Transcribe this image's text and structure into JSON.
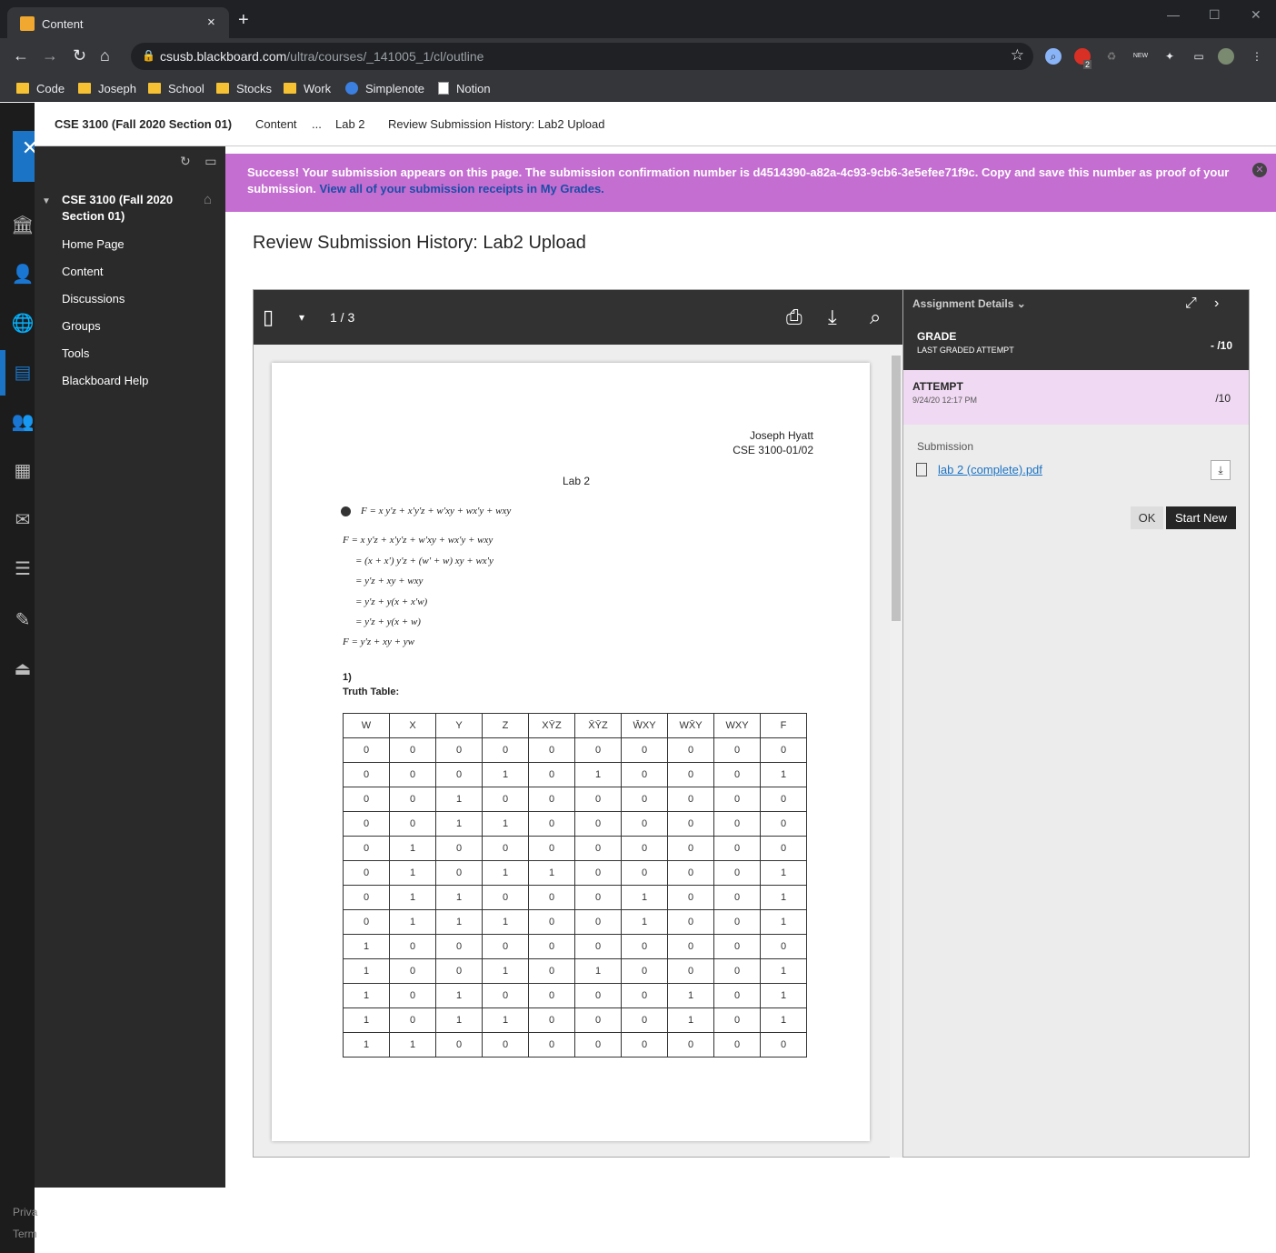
{
  "browser": {
    "tab_title": "Content",
    "tab_close": "×",
    "new_tab": "+",
    "url_host": "csusb.blackboard.com",
    "url_path": "/ultra/courses/_141005_1/cl/outline",
    "window_controls": [
      "—",
      "☐",
      "✕"
    ],
    "extension_badge": "2",
    "bookmarks": [
      {
        "label": "Code",
        "icon": "folder-icon"
      },
      {
        "label": "Joseph",
        "icon": "folder-icon"
      },
      {
        "label": "School",
        "icon": "folder-icon"
      },
      {
        "label": "Stocks",
        "icon": "folder-icon"
      },
      {
        "label": "Work",
        "icon": "folder-icon"
      },
      {
        "label": "Simplenote",
        "icon": "simplenote-icon"
      },
      {
        "label": "Notion",
        "icon": "notion-icon"
      }
    ]
  },
  "breadcrumb": {
    "course": "CSE 3100 (Fall 2020 Section 01)",
    "items": [
      "Content",
      "...",
      "Lab 2",
      "Review Submission History: Lab2 Upload"
    ]
  },
  "rail": {
    "close_glyph": "✕",
    "footer": [
      "Priva",
      "Term"
    ]
  },
  "sidebar": {
    "course_title": "CSE 3100 (Fall 2020 Section 01)",
    "items": [
      "Home Page",
      "Content",
      "Discussions",
      "Groups",
      "Tools",
      "Blackboard Help"
    ]
  },
  "success": {
    "message": "Success! Your submission appears on this page. The submission confirmation number is d4514390-a82a-4c93-9cb6-3e5efee71f9c. Copy and save this number as proof of your submission.",
    "link": "View all of your submission receipts in My Grades.",
    "close_glyph": "✕"
  },
  "page_title": "Review Submission History: Lab2 Upload",
  "viewer": {
    "page_indicator": "1 / 3",
    "document": {
      "author_name": "Joseph Hyatt",
      "author_course": "CSE 3100-01/02",
      "title": "Lab 2",
      "equation_top": "F = x y'z + x'y'z + w'xy + wx'y + wxy",
      "derivation": [
        "F = x y'z + x'y'z + w'xy + wx'y + wxy",
        "= (x + x') y'z + (w' + w) xy + wx'y",
        "= y'z + xy + wxy",
        "= y'z + y(x + x'w)",
        "= y'z + y(x + w)",
        "F = y'z + xy + yw"
      ],
      "question_number": "1)",
      "question_label": "Truth Table:",
      "truth_table": {
        "headers": [
          "W",
          "X",
          "Y",
          "Z",
          "XȲZ",
          "X̄ȲZ",
          "W̄XY",
          "WX̄Y",
          "WXY",
          "F"
        ],
        "rows": [
          [
            "0",
            "0",
            "0",
            "0",
            "0",
            "0",
            "0",
            "0",
            "0",
            "0"
          ],
          [
            "0",
            "0",
            "0",
            "1",
            "0",
            "1",
            "0",
            "0",
            "0",
            "1"
          ],
          [
            "0",
            "0",
            "1",
            "0",
            "0",
            "0",
            "0",
            "0",
            "0",
            "0"
          ],
          [
            "0",
            "0",
            "1",
            "1",
            "0",
            "0",
            "0",
            "0",
            "0",
            "0"
          ],
          [
            "0",
            "1",
            "0",
            "0",
            "0",
            "0",
            "0",
            "0",
            "0",
            "0"
          ],
          [
            "0",
            "1",
            "0",
            "1",
            "1",
            "0",
            "0",
            "0",
            "0",
            "1"
          ],
          [
            "0",
            "1",
            "1",
            "0",
            "0",
            "0",
            "1",
            "0",
            "0",
            "1"
          ],
          [
            "0",
            "1",
            "1",
            "1",
            "0",
            "0",
            "1",
            "0",
            "0",
            "1"
          ],
          [
            "1",
            "0",
            "0",
            "0",
            "0",
            "0",
            "0",
            "0",
            "0",
            "0"
          ],
          [
            "1",
            "0",
            "0",
            "1",
            "0",
            "1",
            "0",
            "0",
            "0",
            "1"
          ],
          [
            "1",
            "0",
            "1",
            "0",
            "0",
            "0",
            "0",
            "1",
            "0",
            "1"
          ],
          [
            "1",
            "0",
            "1",
            "1",
            "0",
            "0",
            "0",
            "1",
            "0",
            "1"
          ],
          [
            "1",
            "1",
            "0",
            "0",
            "0",
            "0",
            "0",
            "0",
            "0",
            "0"
          ]
        ]
      }
    }
  },
  "panel": {
    "header": "Assignment Details",
    "grade_label": "GRADE",
    "grade_sub": "LAST GRADED ATTEMPT",
    "grade_value": "- /10",
    "attempt_label": "ATTEMPT",
    "attempt_date": "9/24/20 12:17 PM",
    "attempt_value": "/10",
    "submission_label": "Submission",
    "file_name": "lab 2 (complete).pdf",
    "ok_label": "OK",
    "start_new_label": "Start New"
  }
}
